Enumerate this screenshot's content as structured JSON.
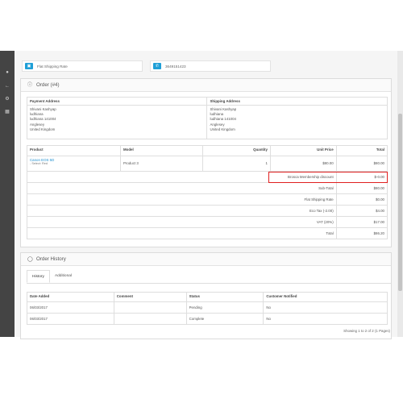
{
  "top_cards": [
    {
      "icon": "truck-icon",
      "text": "Flat Shipping Rate"
    },
    {
      "icon": "phone-icon",
      "text": "3649151423"
    }
  ],
  "sidebar": {
    "icons": [
      "user-icon",
      "share-icon",
      "gear-icon",
      "bar-chart-icon"
    ]
  },
  "order": {
    "title": "Order (#4)",
    "payment_address_label": "Payment Address",
    "shipping_address_label": "Shipping Address",
    "payment_address": [
      "Shivani Kashyap",
      "ludhiana",
      "ludhiana 141004",
      "Anglesey",
      "United Kingdom"
    ],
    "shipping_address": [
      "Shivani Kashyap",
      "ludhiana",
      "ludhiana 141004",
      "Anglesey",
      "United Kingdom"
    ],
    "columns": {
      "product": "Product",
      "model": "Model",
      "quantity": "Quantity",
      "unit_price": "Unit Price",
      "total": "Total"
    },
    "items": [
      {
        "product": "Canon EOS 5D",
        "option": "- Select: Red",
        "model": "Product 3",
        "quantity": "1",
        "unit_price": "$80.00",
        "total": "$80.00"
      }
    ],
    "totals": [
      {
        "label": "Brosca Membership discount",
        "value": "$-0.00"
      },
      {
        "label": "Sub-Total",
        "value": "$80.00"
      },
      {
        "label": "Flat Shipping Rate",
        "value": "$0.00"
      },
      {
        "label": "Eco Tax (-2.00)",
        "value": "$4.00"
      },
      {
        "label": "VAT (20%)",
        "value": "$17.00"
      },
      {
        "label": "Total",
        "value": "$86.20"
      }
    ]
  },
  "history": {
    "title": "Order History",
    "tabs": [
      "History",
      "Additional"
    ],
    "active_tab": "History",
    "columns": {
      "date_added": "Date Added",
      "comment": "Comment",
      "status": "Status",
      "notified": "Customer Notified"
    },
    "rows": [
      {
        "date_added": "06/03/2017",
        "comment": "",
        "status": "Pending",
        "notified": "No"
      },
      {
        "date_added": "06/03/2017",
        "comment": "",
        "status": "Complete",
        "notified": "No"
      }
    ],
    "showing": "Showing 1 to 2 of 2 (1 Pages)"
  }
}
